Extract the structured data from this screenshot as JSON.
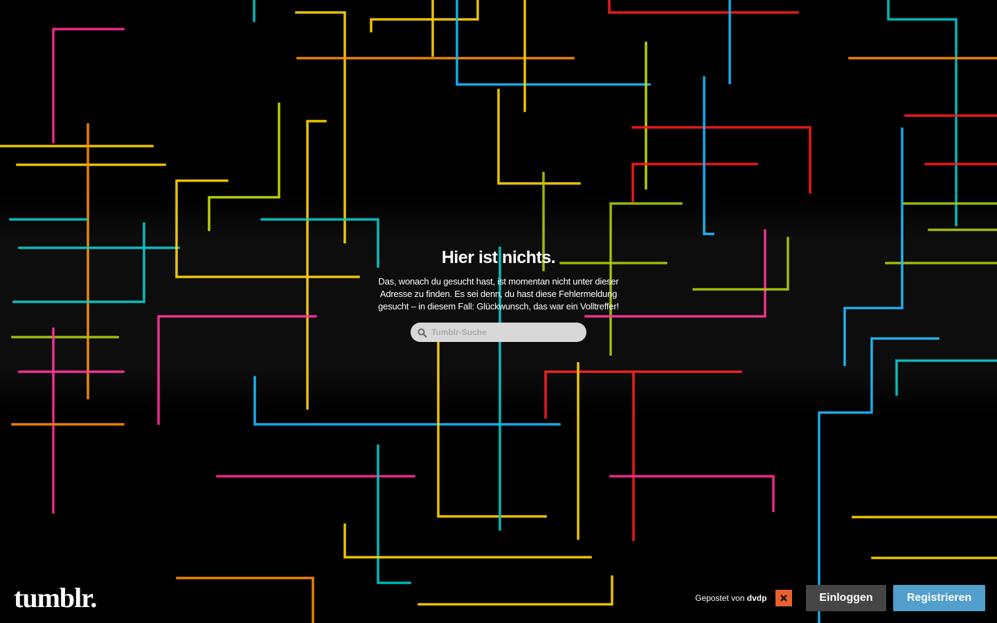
{
  "page": {
    "title": "Hier ist nichts.",
    "description": "Das, wonach du gesucht hast, ist momentan nicht unter dieser Adresse zu finden. Es sei denn, du hast diese Fehlermeldung gesucht – in diesem Fall: Glückwunsch, das war ein Volltreffer!"
  },
  "search": {
    "placeholder": "Tumblr-Suche",
    "icon": "search-icon"
  },
  "footer": {
    "logo": "tumblr.",
    "posted_prefix": "Gepostet von",
    "posted_user": "dvdp",
    "avatar_icon": "avatar-icon",
    "login_label": "Einloggen",
    "register_label": "Registrieren"
  },
  "colors": {
    "background": "#000000",
    "login_button": "#454545",
    "register_button": "#529ecc",
    "line_colors": [
      "#ff1a1a",
      "#ffd400",
      "#c8e000",
      "#00c8c8",
      "#1ab8ff",
      "#ff2d95",
      "#ff8c00",
      "#a8c800"
    ]
  }
}
